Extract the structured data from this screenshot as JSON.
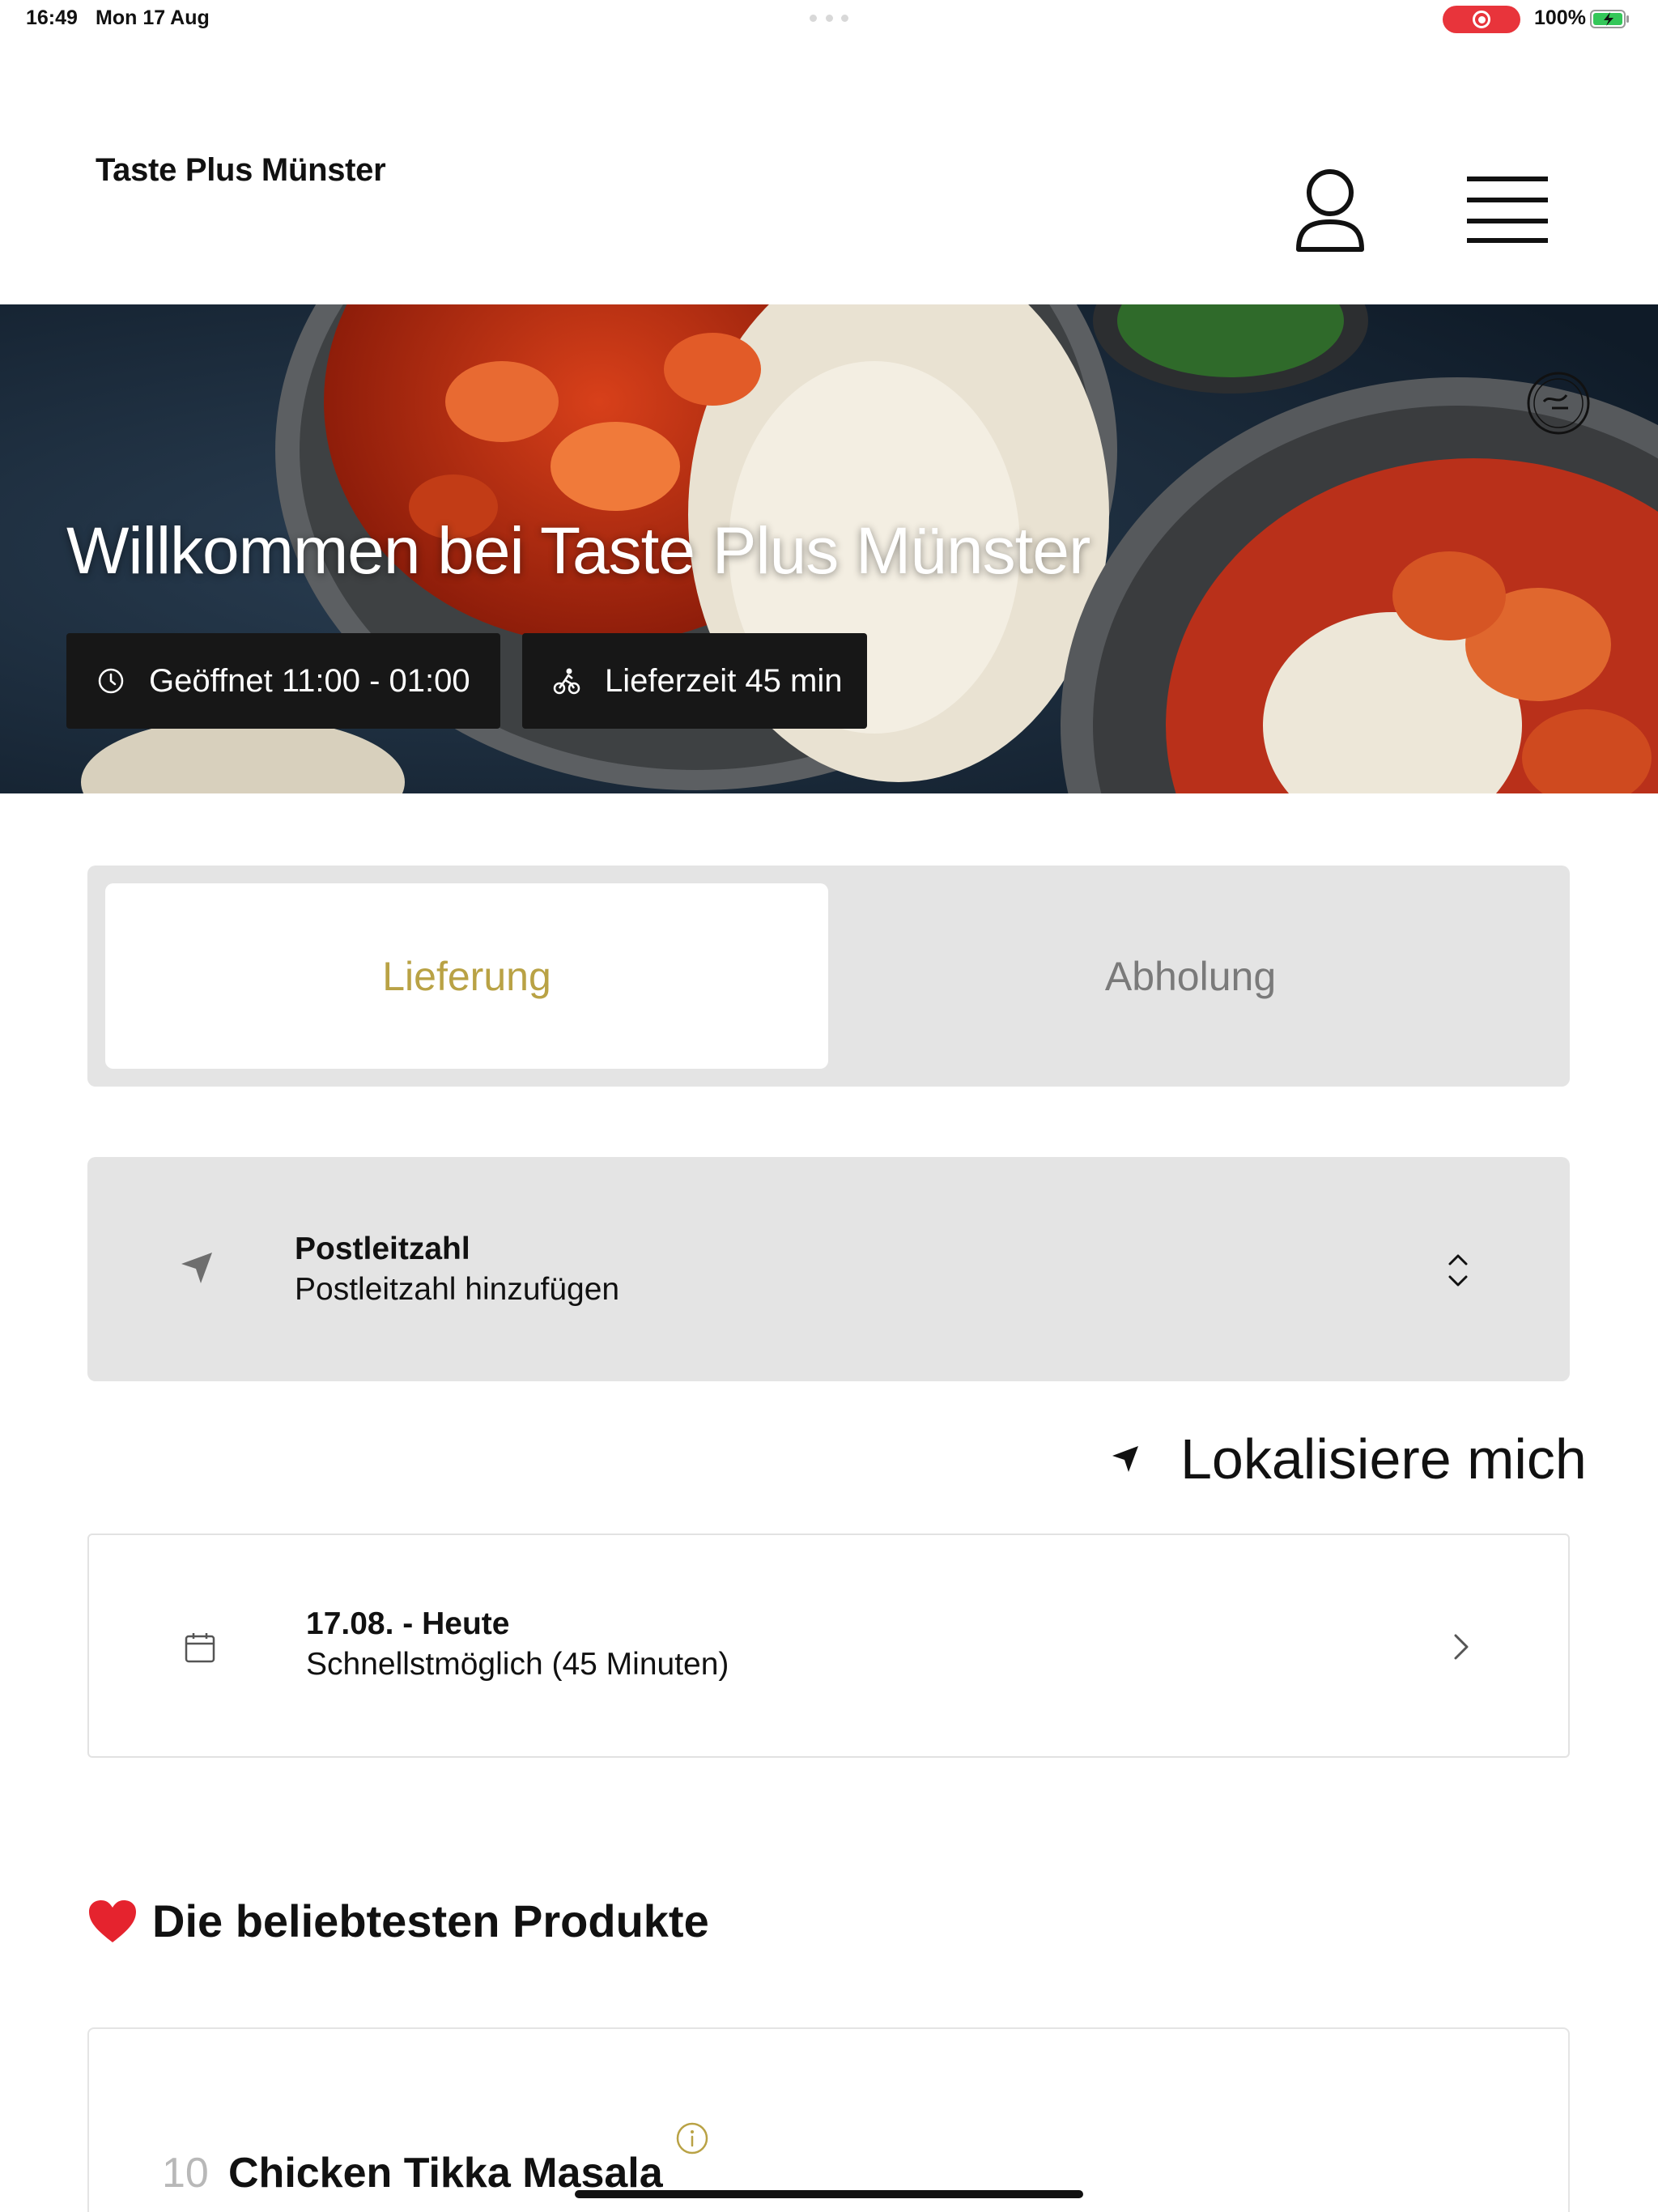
{
  "status_bar": {
    "time": "16:49",
    "date": "Mon 17 Aug",
    "battery": "100%"
  },
  "header": {
    "brand": "Taste Plus Münster",
    "profile_icon": "user-icon",
    "menu_icon": "hamburger-menu-icon"
  },
  "hero": {
    "title": "Willkommen bei Taste Plus Münster",
    "opening_hours": "Geöffnet 11:00 - 01:00",
    "delivery_time": "Lieferzeit 45 min",
    "badge_icon": "halal-badge-icon"
  },
  "order_mode": {
    "tabs": [
      {
        "label": "Lieferung",
        "active": true
      },
      {
        "label": "Abholung",
        "active": false
      }
    ]
  },
  "postcode": {
    "label": "Postleitzahl",
    "value": "Postleitzahl hinzufügen"
  },
  "locate": {
    "label": "Lokalisiere mich"
  },
  "schedule": {
    "title": "17.08. - Heute",
    "subtitle": "Schnellstmöglich (45 Minuten)"
  },
  "popular": {
    "title": "Die beliebtesten Produkte",
    "products": [
      {
        "number": "10",
        "name": "Chicken Tikka Masala"
      }
    ]
  },
  "colors": {
    "accent": "#b9a245",
    "segment_bg": "#e4e4e4",
    "pill_bg": "#171717",
    "recording": "#e8343b"
  }
}
